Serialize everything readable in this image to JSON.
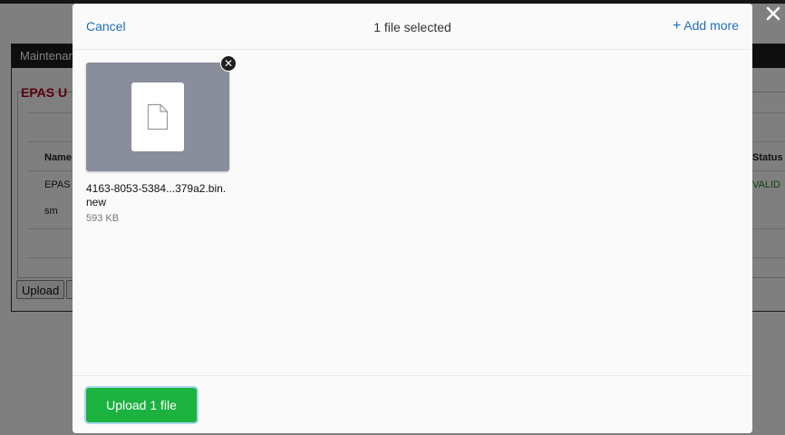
{
  "background": {
    "panel_title": "Maintenan",
    "section_title": "EPAS U",
    "table": {
      "col_name": "Name",
      "col_status": "Status",
      "rows": [
        {
          "name": "EPAS",
          "status": "VALID"
        },
        {
          "name": "sm",
          "status": ""
        }
      ]
    },
    "upload_label": "Upload"
  },
  "modal": {
    "cancel_label": "Cancel",
    "title": "1 file selected",
    "add_more_label": "Add more",
    "files": [
      {
        "name": "4163-8053-5384...379a2.bin.new",
        "size": "593 KB",
        "icon": "file-icon"
      }
    ],
    "upload_button_label": "Upload 1 file"
  },
  "colors": {
    "accent_link": "#1f6fb8",
    "upload_green": "#1bb240",
    "preview_bg": "#8a8d9b",
    "valid_green": "#1a8f2d",
    "section_red": "#b3001b"
  }
}
